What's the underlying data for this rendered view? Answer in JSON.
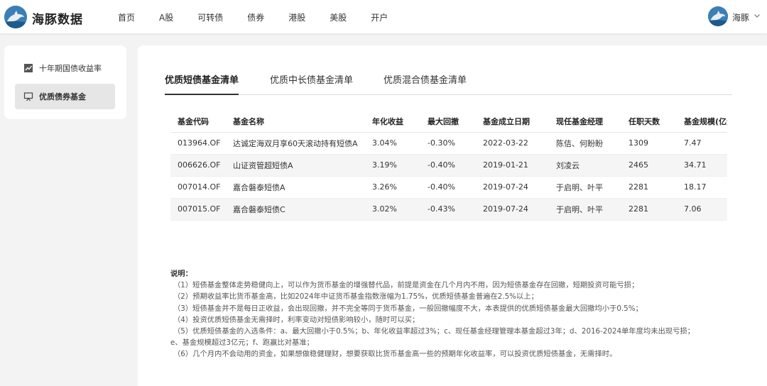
{
  "header": {
    "brand": "海豚数据",
    "nav": [
      "首页",
      "A股",
      "可转债",
      "债券",
      "港股",
      "美股",
      "开户"
    ],
    "user": "海豚"
  },
  "sidebar": {
    "items": [
      {
        "label": "十年期国债收益率",
        "icon": "line-chart-icon",
        "active": false
      },
      {
        "label": "优质债券基金",
        "icon": "presentation-board-icon",
        "active": true
      }
    ]
  },
  "main": {
    "tabs": [
      "优质短债基金清单",
      "优质中长债基金清单",
      "优质混合债基金清单"
    ],
    "table": {
      "columns": [
        "基金代码",
        "基金名称",
        "年化收益",
        "最大回撤",
        "基金成立日期",
        "现任基金经理",
        "任职天数",
        "基金规模(亿元)"
      ],
      "rows": [
        [
          "013964.OF",
          "达诚定海双月享60天滚动持有短债A",
          "3.04%",
          "-0.30%",
          "2022-03-22",
          "陈佶、何盼盼",
          "1309",
          "7.47"
        ],
        [
          "006626.OF",
          "山证资管超短债A",
          "3.19%",
          "-0.40%",
          "2019-01-21",
          "刘凌云",
          "2465",
          "34.71"
        ],
        [
          "007014.OF",
          "嘉合磐泰短债A",
          "3.26%",
          "-0.40%",
          "2019-07-24",
          "于启明、叶平",
          "2281",
          "18.17"
        ],
        [
          "007015.OF",
          "嘉合磐泰短债C",
          "3.02%",
          "-0.43%",
          "2019-07-24",
          "于启明、叶平",
          "2281",
          "7.06"
        ]
      ]
    },
    "notes": {
      "title": "说明：",
      "lines": [
        "（1）短债基金整体走势稳健向上，可以作为货币基金的增强替代品，前提是资金在几个月内不用，因为短债基金存在回撤，短期投资可能亏损；",
        "（2）预期收益率比货币基金高，比如2024年中证货币基金指数涨幅为1.75%，优质短债基金普遍在2.5%以上；",
        "（3）短债基金并不是每日正收益，会出现回撤，并不完全等同于货币基金，一般回撤幅度不大，本表提供的优质短债基金最大回撤均小于0.5%；",
        "（4）投资优质短债基金无需择时，利率变动对短债影响较小，随时可以买；",
        "（5）优质短债基金的入选条件：a、最大回撤小于0.5%；b、年化收益率超过3%；c、现任基金经理管理本基金超过3年；d、2016-2024单年度均未出现亏损；",
        "e、基金规模超过3亿元；f、跑赢比对基准；",
        "（6）几个月内不会动用的资金，如果想做稳健理财，想要获取比货币基金高一些的预期年化收益率，可以投资优质短债基金，无需择时。"
      ]
    }
  },
  "colors": {
    "brand_blue": "#2e6fa3",
    "active_bg": "#e6e6e6"
  }
}
